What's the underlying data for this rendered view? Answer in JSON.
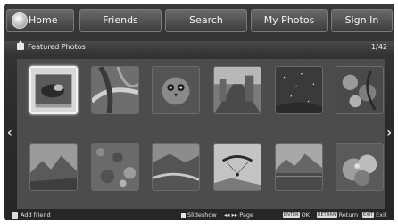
{
  "nav": {
    "home_label": "Home",
    "friends_label": "Friends",
    "search_label": "Search",
    "photos_label": "My Photos",
    "signin_label": "Sign In"
  },
  "featured": {
    "title": "Featured Photos",
    "page_count": "1/42"
  },
  "photos": [
    {
      "subject": "bird-in-frame",
      "selected": true
    },
    {
      "subject": "twisted-branches"
    },
    {
      "subject": "owl-portrait"
    },
    {
      "subject": "street-scene"
    },
    {
      "subject": "night-sky"
    },
    {
      "subject": "flowers-and-leaves"
    },
    {
      "subject": "mountain-landscape"
    },
    {
      "subject": "textured-rock"
    },
    {
      "subject": "valley-river"
    },
    {
      "subject": "paraglider-sky"
    },
    {
      "subject": "lake-mountains"
    },
    {
      "subject": "fruit-closeup"
    }
  ],
  "bottom": {
    "add_friend": "Add friend",
    "slideshow": "Slideshow",
    "page_keys": "◂◂ ▸▸",
    "page_label": "Page",
    "ok_key": "ENTER",
    "ok_label": "OK",
    "return_key": "RETURN",
    "return_label": "Return",
    "exit_key": "EXIT",
    "exit_label": "Exit"
  },
  "colors": {
    "background": "#2c2c2c",
    "grid_panel": "#4c4c4c",
    "nav_button": "#505050",
    "text": "#f0f0f0",
    "selection": "#f2f2f2"
  },
  "icons": {
    "home": "home-logo-icon",
    "featured": "house-icon",
    "prev": "chevron-left-icon",
    "next": "chevron-right-icon",
    "add_friend": "person-add-icon"
  }
}
